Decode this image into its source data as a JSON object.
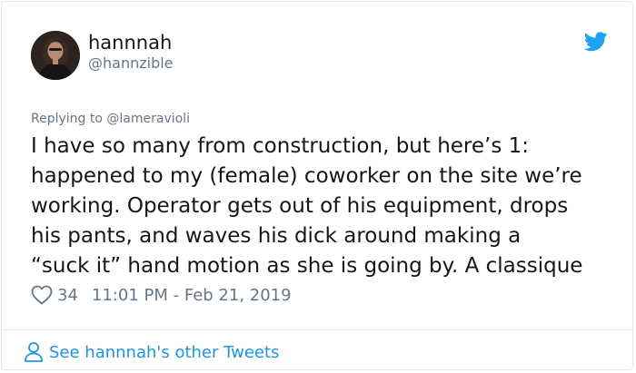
{
  "user": {
    "display_name": "hannnah",
    "handle": "@hannzible"
  },
  "reply": {
    "prefix": "Replying to",
    "mention": "@lameravioli"
  },
  "tweet": {
    "lines": [
      "I have so many from construction, but here’s 1:",
      "happened to my (female) coworker on the site we’re",
      "working. Operator gets out of his equipment, drops",
      "his pants, and waves his dick around making a",
      "“suck it” hand motion as she is going by. A classique"
    ]
  },
  "meta": {
    "like_count": "34",
    "timestamp": "11:01 PM - Feb 21, 2019"
  },
  "footer": {
    "link_text": "See hannnah's other Tweets"
  },
  "icons": {
    "brand": "twitter-bird-icon",
    "like": "heart-icon",
    "footer": "person-icon"
  },
  "colors": {
    "brand_blue": "#1da1f2",
    "link_blue": "#1b95e0",
    "secondary_text": "#657786",
    "primary_text": "#14171a",
    "border": "#e1e8ed"
  }
}
